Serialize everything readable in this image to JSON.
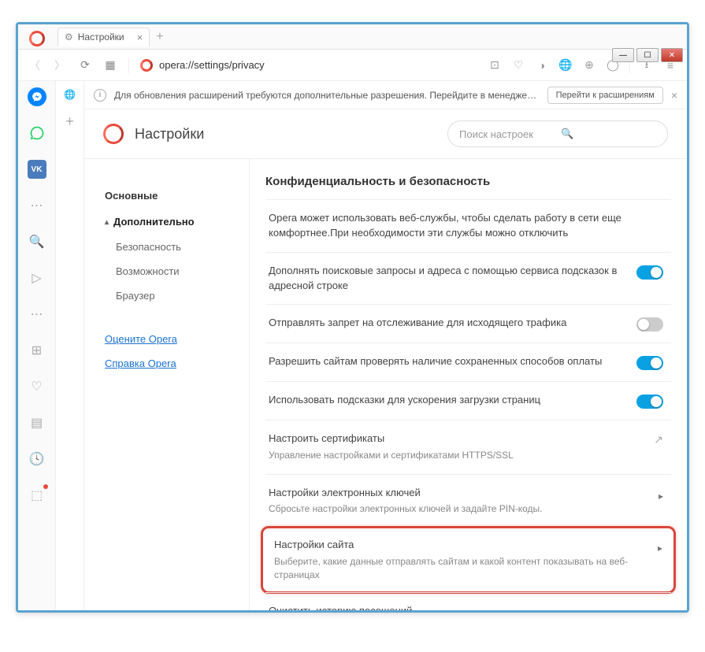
{
  "tab": {
    "title": "Настройки"
  },
  "url": "opera://settings/privacy",
  "infobar": {
    "message": "Для обновления расширений требуются дополнительные разрешения. Перейдите в менеджер р...",
    "button": "Перейти к расширениям"
  },
  "header": {
    "title": "Настройки",
    "search_placeholder": "Поиск настроек"
  },
  "nav": {
    "basic": "Основные",
    "advanced": "Дополнительно",
    "security": "Безопасность",
    "features": "Возможности",
    "browser": "Браузер",
    "rate": "Оцените Opera",
    "help": "Справка Opera"
  },
  "section": {
    "title": "Конфиденциальность и безопасность",
    "intro": "Opera может использовать веб-службы, чтобы сделать работу в сети еще комфортнее.При необходимости эти службы можно отключить",
    "r1": "Дополнять поисковые запросы и адреса с помощью сервиса подсказок в адресной строке",
    "r2": "Отправлять запрет на отслеживание для исходящего трафика",
    "r3": "Разрешить сайтам проверять наличие сохраненных способов оплаты",
    "r4": "Использовать подсказки для ускорения загрузки страниц",
    "cert_title": "Настроить сертификаты",
    "cert_sub": "Управление настройками и сертификатами HTTPS/SSL",
    "keys_title": "Настройки электронных ключей",
    "keys_sub": "Сбросьте настройки электронных ключей и задайте PIN-коды.",
    "site_title": "Настройки сайта",
    "site_sub": "Выберите, какие данные отправлять сайтам и какой контент показывать на веб-страницах",
    "clear": "Очистить историю посещений"
  }
}
